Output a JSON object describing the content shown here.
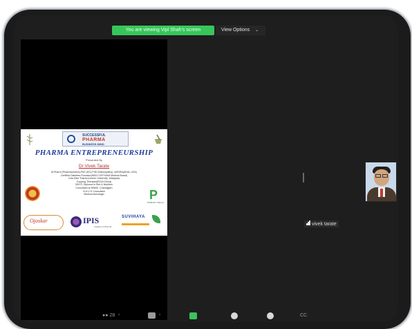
{
  "sharing_banner": "You are viewing Vipl Shah's screen",
  "view_options": {
    "label": "View Options",
    "caret": "⌄"
  },
  "slide": {
    "logo_top": "SUCCESSFUL",
    "logo_main": "PHARMA",
    "logo_sub": "BUSINESS MIND",
    "title": "PHARMA ENTREPRENEURSHIP",
    "presented_by": "Presented By",
    "presenter": "Dr Vivek Tarate",
    "credentials": [
      "M.Pharm (Pharmaceutics),PhD (HC),PhD (Naturopathy) ,ADDRA(ADAL,USA)",
      "Certified Diabetes Educator(INDO-VIETNAM Medical Board)",
      "Cole-Bize Trainer(Lincoln University ,Malaysia)",
      "Cupping Therapist(RCM-China)",
      "DNYS, Diploma in Diet & Nutrition",
      "Consultant at HBMS, Chandigarh",
      "N.H.C.E Consultant",
      "Medical Astrologer"
    ],
    "logo_p_text": "PRIMARY WELLS",
    "logo_ojaskar": "Ojaskar",
    "logo_ipis": "IPIS",
    "logo_ipis_sub": "Institute of Pharma",
    "logo_suvidha": "SUVIHAYA"
  },
  "participant": {
    "name": "vivek tarate"
  },
  "toolbar": {
    "participants_count": "28",
    "caret": "^",
    "cc_label": "CC"
  },
  "colors": {
    "share_green": "#38c65b",
    "background": "#1e1e1e"
  }
}
